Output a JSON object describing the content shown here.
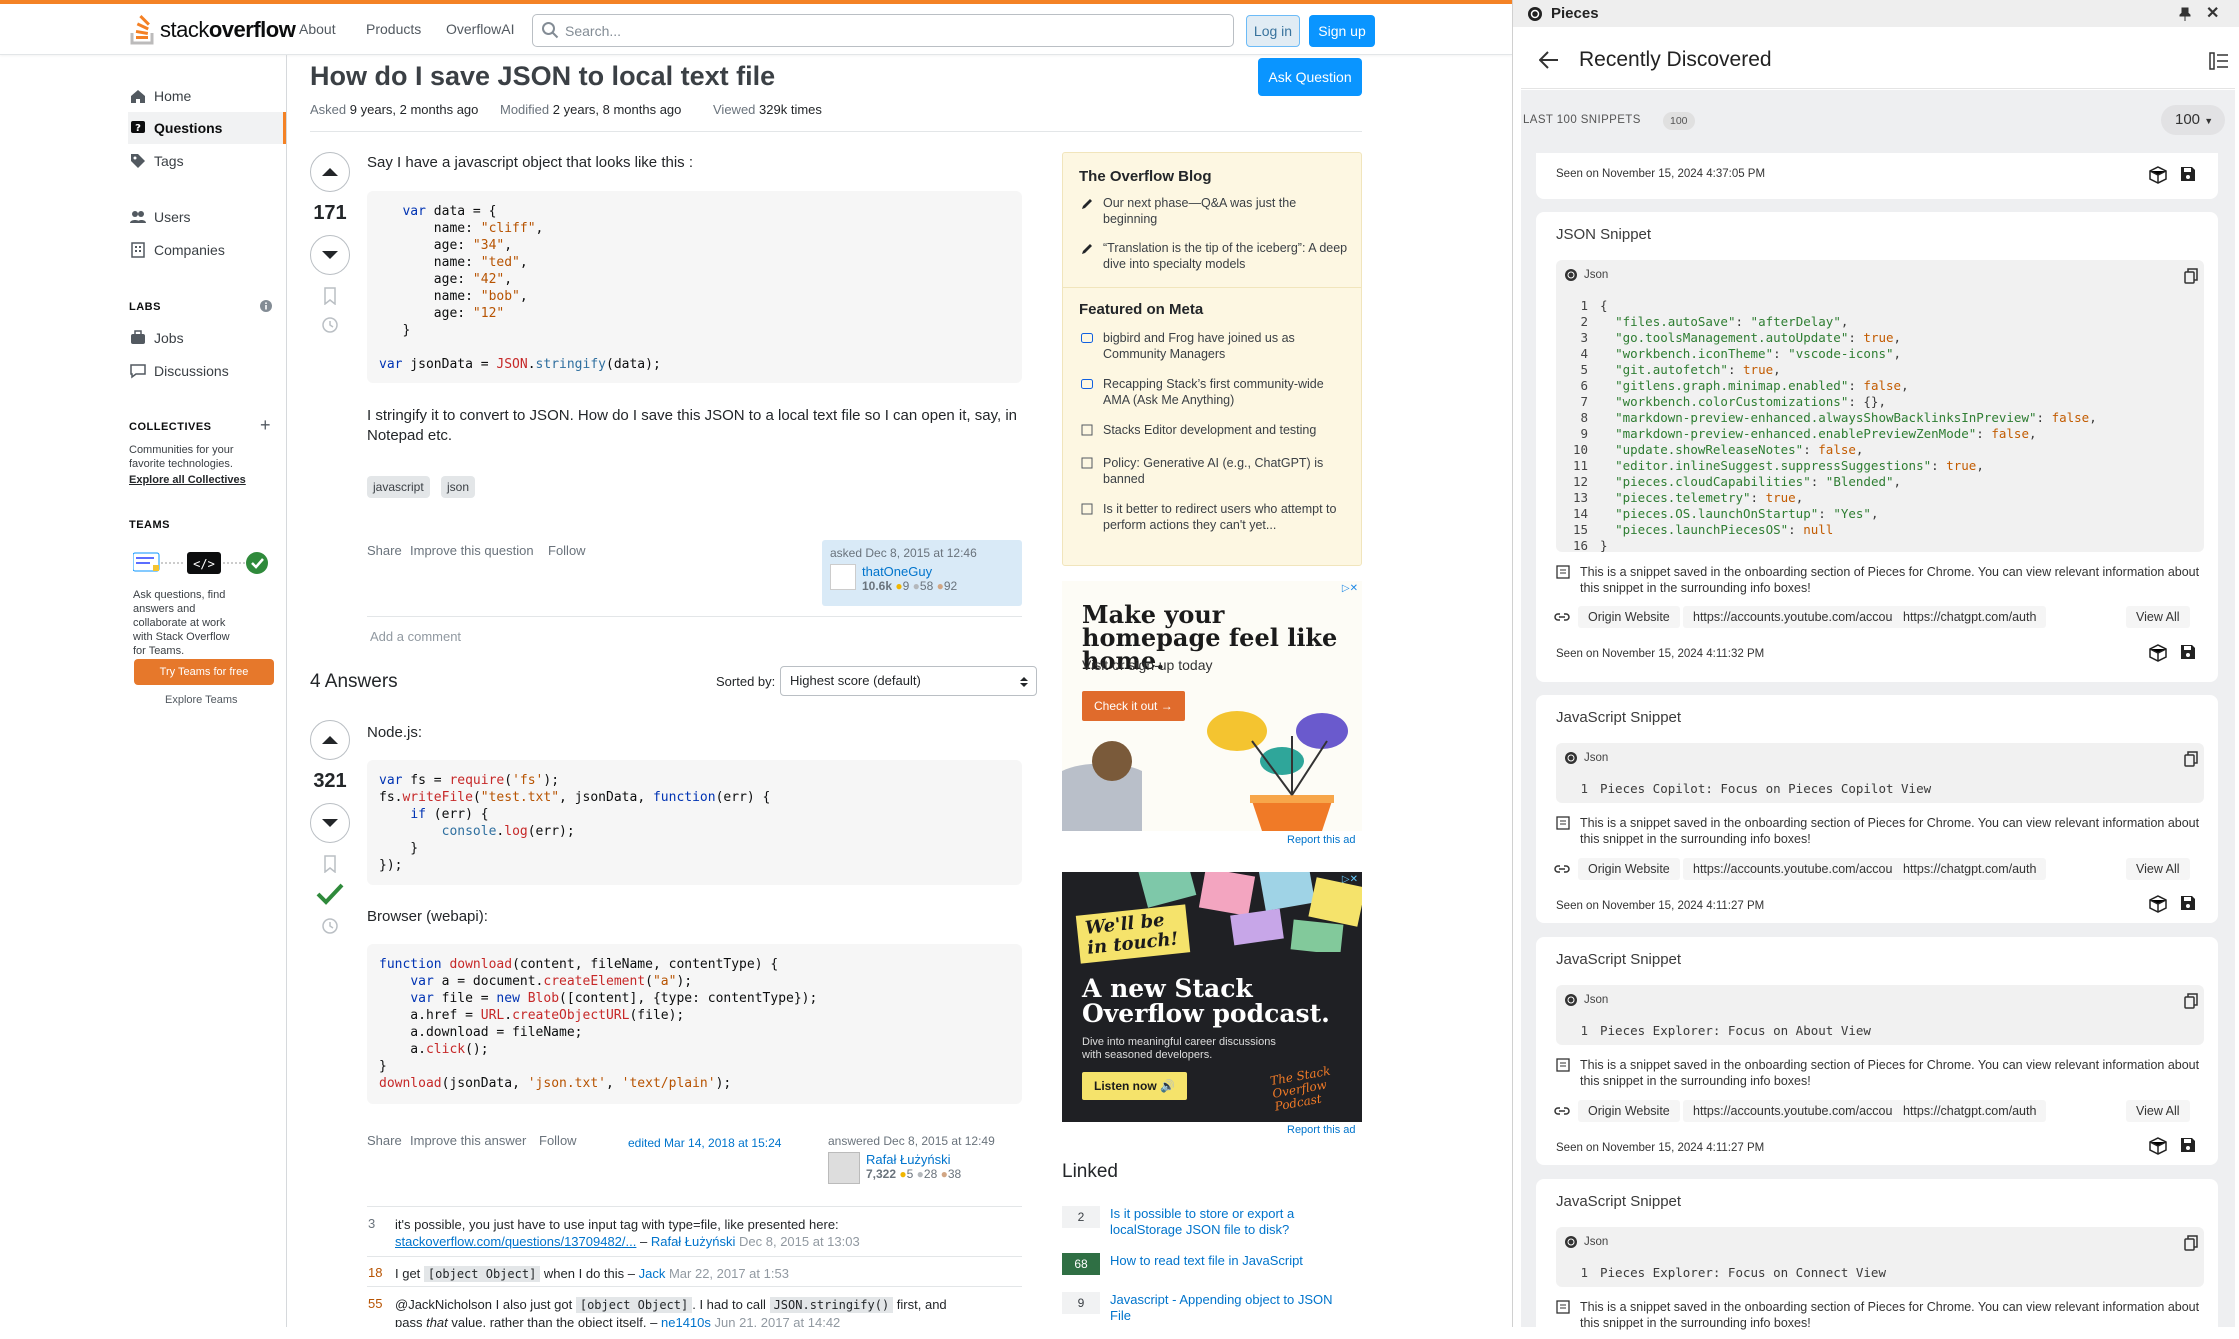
{
  "so": {
    "logo": {
      "plain": "stack",
      "bold": "overflow"
    },
    "topnav": [
      "About",
      "Products",
      "OverflowAI"
    ],
    "search_placeholder": "Search...",
    "login": "Log in",
    "signup": "Sign up",
    "nav": {
      "home": "Home",
      "questions": "Questions",
      "tags": "Tags",
      "users": "Users",
      "companies": "Companies",
      "labs_label": "LABS",
      "jobs": "Jobs",
      "discussions": "Discussions",
      "collectives_label": "COLLECTIVES",
      "collectives_text": "Communities for your favorite technologies.",
      "collectives_link": "Explore all Collectives",
      "teams_label": "TEAMS",
      "teams_text": "Ask questions, find answers and collaborate at work with Stack Overflow for Teams.",
      "teams_btn": "Try Teams for free",
      "teams_explore": "Explore Teams"
    },
    "question": {
      "title": "How do I save JSON to local text file",
      "ask_button": "Ask Question",
      "asked_label": "Asked",
      "asked_value": "9 years, 2 months ago",
      "modified_label": "Modified",
      "modified_value": "2 years, 8 months ago",
      "viewed_label": "Viewed",
      "viewed_value": "329k times",
      "score": "171",
      "intro": "Say I have a javascript object that looks like this :",
      "body": "I stringify it to convert to JSON. How do I save this JSON to a local text file so I can open it, say, in Notepad etc.",
      "tags": [
        "javascript",
        "json"
      ],
      "actions": [
        "Share",
        "Improve this question",
        "Follow"
      ],
      "asked_on": "asked Dec 8, 2015 at 12:46",
      "user": "thatOneGuy",
      "rep": "10.6k",
      "gold": "9",
      "silver": "58",
      "bronze": "92",
      "add_comment": "Add a comment"
    },
    "answers": {
      "count_label": "4 Answers",
      "sorted_label": "Sorted by:",
      "sort_value": "Highest score (default)",
      "a1": {
        "score": "321",
        "intro1": "Node.js:",
        "intro2": "Browser (webapi):",
        "actions": [
          "Share",
          "Improve this answer",
          "Follow"
        ],
        "edited": "edited Mar 14, 2018 at 15:24",
        "answered": "answered Dec 8, 2015 at 12:49",
        "user": "Rafał Łużyński",
        "rep": "7,322",
        "gold": "5",
        "silver": "28",
        "bronze": "38"
      },
      "comments": [
        {
          "score": "3",
          "text": "it's possible, you just have to use input tag with type=file, like presented here:",
          "link": "stackoverflow.com/questions/13709482/...",
          "user": "Rafał Łużyński",
          "date": "Dec 8, 2015 at 13:03"
        },
        {
          "score": "18",
          "pre": "I get",
          "code": "[object Object]",
          "post": "when I do this –",
          "user": "Jack",
          "date": "Mar 22, 2017 at 1:53"
        },
        {
          "score": "55",
          "pre": "@JackNicholson I also just got",
          "code": "[object Object]",
          "mid": ". I had to call",
          "code2": "JSON.stringify()",
          "post": "first, and",
          "line2a": "pass",
          "line2i": "that",
          "line2b": "value, rather than the object itself. –",
          "user": "ne1410s",
          "date": "Jun 21, 2017 at 14:42"
        }
      ]
    },
    "sidebar": {
      "blog_title": "The Overflow Blog",
      "blog": [
        "Our next phase—Q&A was just the beginning",
        "“Translation is the tip of the iceberg”: A deep dive into specialty models"
      ],
      "meta_title": "Featured on Meta",
      "meta": [
        "bigbird and Frog have joined us as Community Managers",
        "Recapping Stack’s first community-wide AMA (Ask Me Anything)",
        "Stacks Editor development and testing",
        "Policy: Generative AI (e.g., ChatGPT) is banned",
        "Is it better to redirect users who attempt to perform actions they can't yet..."
      ],
      "ad1": {
        "headline": "Make your homepage feel like home.",
        "sub": "Visit or sign-up today",
        "cta": "Check it out"
      },
      "ad2": {
        "tag": "We'll be in touch!",
        "headline": "A new Stack Overflow podcast.",
        "sub": "Dive into meaningful career discussions with seasoned developers.",
        "cta": "Listen now",
        "brand": "The Stack Overflow Podcast"
      },
      "report": "Report this ad",
      "linked_title": "Linked",
      "linked": [
        {
          "score": "2",
          "title": "Is it possible to store or export a localStorage JSON file to disk?",
          "accepted": false
        },
        {
          "score": "68",
          "title": "How to read text file in JavaScript",
          "accepted": true
        },
        {
          "score": "9",
          "title": "Javascript - Appending object to JSON File",
          "accepted": false
        }
      ]
    }
  },
  "pieces": {
    "app_title": "Pieces",
    "view_title": "Recently Discovered",
    "last_label": "LAST 100 SNIPPETS",
    "last_count": "100",
    "limit_select": "100",
    "first_seen": "Seen on November 15, 2024 4:37:05 PM",
    "cards": [
      {
        "title": "JSON Snippet",
        "lang": "Json",
        "lines": [
          "{",
          "  \"files.autoSave\": \"afterDelay\",",
          "  \"go.toolsManagement.autoUpdate\": true,",
          "  \"workbench.iconTheme\": \"vscode-icons\",",
          "  \"git.autofetch\": true,",
          "  \"gitlens.graph.minimap.enabled\": false,",
          "  \"workbench.colorCustomizations\": {},",
          "  \"markdown-preview-enhanced.alwaysShowBacklinksInPreview\": false,",
          "  \"markdown-preview-enhanced.enablePreviewZenMode\": false,",
          "  \"update.showReleaseNotes\": false,",
          "  \"editor.inlineSuggest.suppressSuggestions\": true,",
          "  \"pieces.cloudCapabilities\": \"Blended\",",
          "  \"pieces.telemetry\": true,",
          "  \"pieces.OS.launchOnStartup\": \"Yes\",",
          "  \"pieces.launchPiecesOS\": null",
          "}"
        ],
        "desc": "This is a snippet saved in the onboarding section of Pieces for Chrome. You can view relevant information about this snippet in the surrounding info boxes!",
        "origin": "Origin Website",
        "url1": "https://accounts.youtube.com/accounts/SetSID",
        "url2": "https://chatgpt.com/auth",
        "view_all": "View All",
        "seen": "Seen on November 15, 2024 4:11:32 PM"
      },
      {
        "title": "JavaScript Snippet",
        "lang": "Json",
        "lines": [
          "Pieces Copilot: Focus on Pieces Copilot View"
        ],
        "desc": "This is a snippet saved in the onboarding section of Pieces for Chrome. You can view relevant information about this snippet in the surrounding info boxes!",
        "origin": "Origin Website",
        "url1": "https://accounts.youtube.com/accounts/SetSID",
        "url2": "https://chatgpt.com/auth",
        "view_all": "View All",
        "seen": "Seen on November 15, 2024 4:11:27 PM"
      },
      {
        "title": "JavaScript Snippet",
        "lang": "Json",
        "lines": [
          "Pieces Explorer: Focus on About View"
        ],
        "desc": "This is a snippet saved in the onboarding section of Pieces for Chrome. You can view relevant information about this snippet in the surrounding info boxes!",
        "origin": "Origin Website",
        "url1": "https://accounts.youtube.com/accounts/SetSID",
        "url2": "https://chatgpt.com/auth",
        "view_all": "View All",
        "seen": "Seen on November 15, 2024 4:11:27 PM"
      },
      {
        "title": "JavaScript Snippet",
        "lang": "Json",
        "lines": [
          "Pieces Explorer: Focus on Connect View"
        ],
        "desc": "This is a snippet saved in the onboarding section of Pieces for Chrome. You can view relevant information about this snippet in the surrounding info boxes!"
      }
    ]
  }
}
